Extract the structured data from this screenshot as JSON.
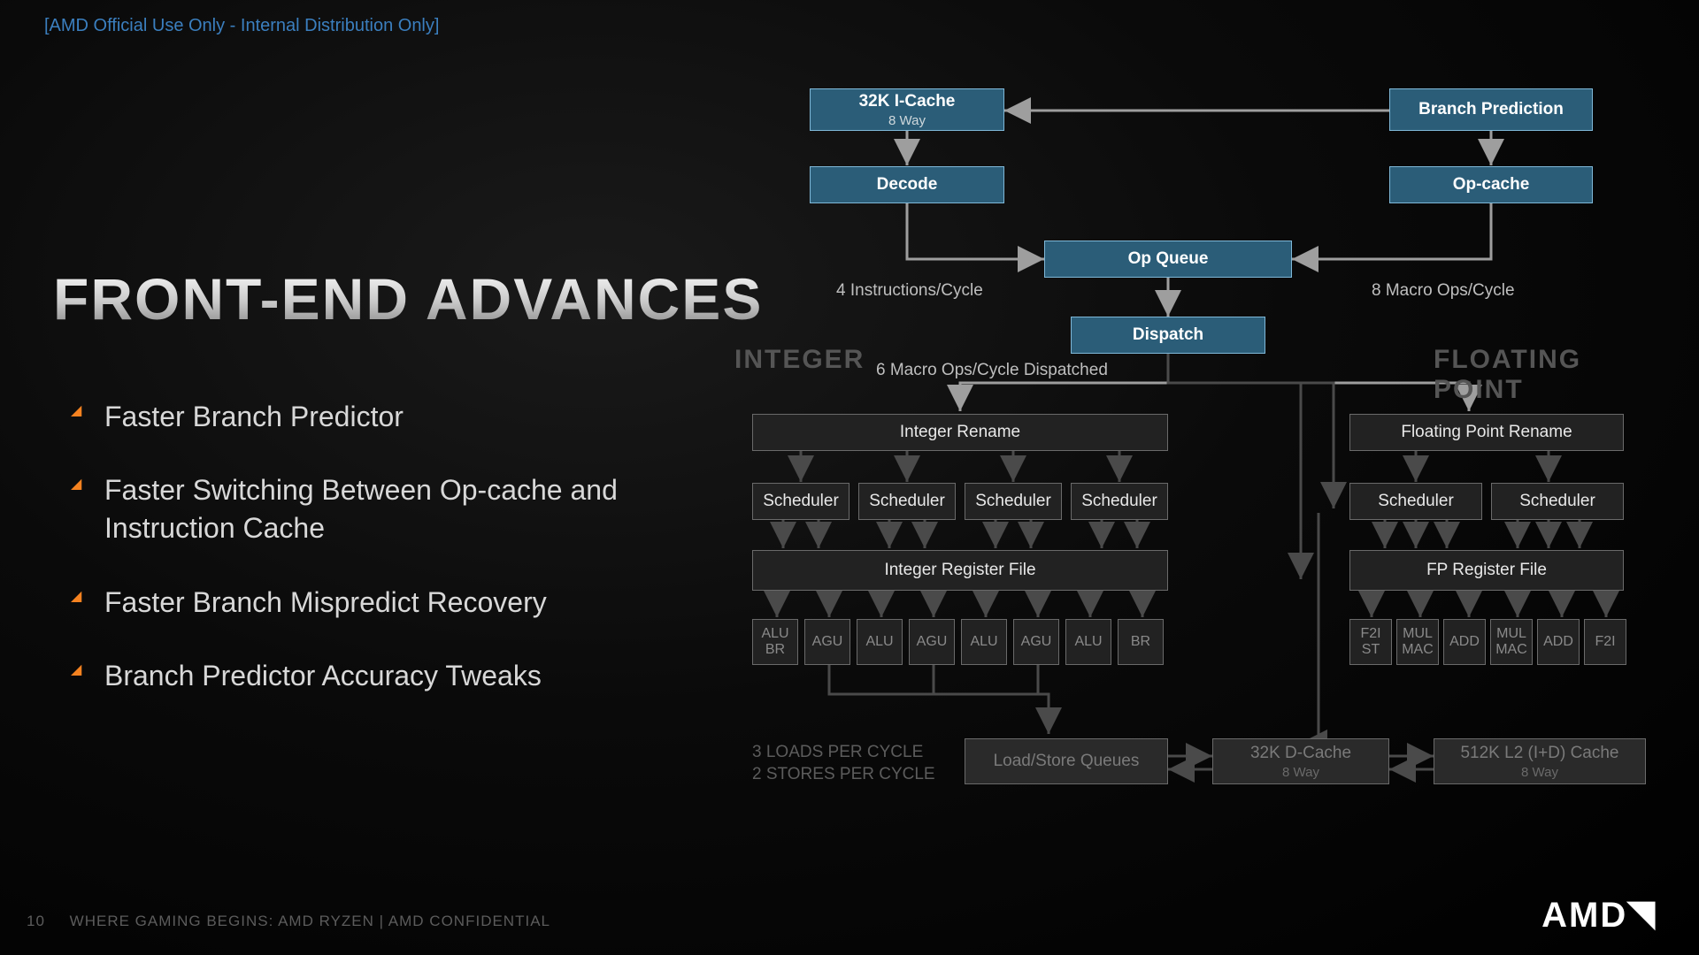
{
  "classification": "[AMD Official Use Only - Internal Distribution Only]",
  "title": "FRONT-END ADVANCES",
  "bullets": [
    "Faster Branch Predictor",
    "Faster Switching Between Op-cache and Instruction Cache",
    "Faster Branch Mispredict Recovery",
    "Branch Predictor Accuracy Tweaks"
  ],
  "footer_page": "10",
  "footer_text": "WHERE GAMING BEGINS:  AMD RYZEN   |   AMD CONFIDENTIAL",
  "logo": "AMD",
  "sections": {
    "int": "INTEGER",
    "fp": "FLOATING POINT"
  },
  "captions": {
    "instr": "4 Instructions/Cycle",
    "macro_in": "8 Macro Ops/Cycle",
    "macro_dispatch": "6 Macro Ops/Cycle Dispatched",
    "loads": "3 LOADS PER CYCLE",
    "stores": "2 STORES PER CYCLE"
  },
  "blocks": {
    "icache": {
      "t": "32K I-Cache",
      "s": "8 Way"
    },
    "bp": "Branch Prediction",
    "decode": "Decode",
    "opcache": "Op-cache",
    "opq": "Op Queue",
    "dispatch": "Dispatch",
    "irename": "Integer Rename",
    "fprename": "Floating Point Rename",
    "sched": "Scheduler",
    "iregfile": "Integer Register File",
    "fpregfile": "FP Register File",
    "units_int": [
      "ALU\nBR",
      "AGU",
      "ALU",
      "AGU",
      "ALU",
      "AGU",
      "ALU",
      "BR"
    ],
    "units_fp": [
      "F2I\nST",
      "MUL\nMAC",
      "ADD",
      "MUL\nMAC",
      "ADD",
      "F2I"
    ],
    "lsq": "Load/Store Queues",
    "dcache": {
      "t": "32K D-Cache",
      "s": "8 Way"
    },
    "l2": {
      "t": "512K L2 (I+D) Cache",
      "s": "8 Way"
    }
  }
}
